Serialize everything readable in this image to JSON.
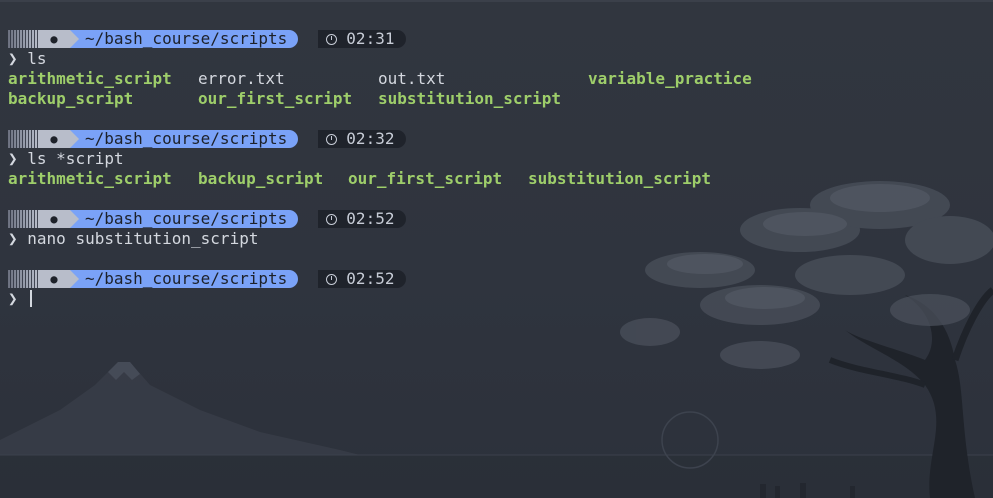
{
  "prompt": {
    "os_icon": "apple-icon",
    "path": "~/bash_course/scripts",
    "clock_icon": "clock-icon",
    "chevron": "❯"
  },
  "blocks": [
    {
      "time": "02:31",
      "command": "ls",
      "output_rows": [
        [
          {
            "name": "arithmetic_script",
            "type": "executable"
          },
          {
            "name": "error.txt",
            "type": "file"
          },
          {
            "name": "out.txt",
            "type": "file"
          },
          {
            "name": "variable_practice",
            "type": "executable"
          }
        ],
        [
          {
            "name": "backup_script",
            "type": "executable"
          },
          {
            "name": "our_first_script",
            "type": "executable"
          },
          {
            "name": "substitution_script",
            "type": "executable"
          }
        ]
      ]
    },
    {
      "time": "02:32",
      "command": "ls *script",
      "output_rows": [
        [
          {
            "name": "arithmetic_script",
            "type": "executable"
          },
          {
            "name": "backup_script",
            "type": "executable"
          },
          {
            "name": "our_first_script",
            "type": "executable"
          },
          {
            "name": "substitution_script",
            "type": "executable"
          }
        ]
      ]
    },
    {
      "time": "02:52",
      "command": "nano substitution_script",
      "output_rows": []
    },
    {
      "time": "02:52",
      "command": "",
      "output_rows": []
    }
  ],
  "colors": {
    "background": "#2e3340",
    "path_segment": "#7aa2f7",
    "time_segment": "#1f232b",
    "executable": "#9ece6a",
    "text": "#d4d8df"
  }
}
